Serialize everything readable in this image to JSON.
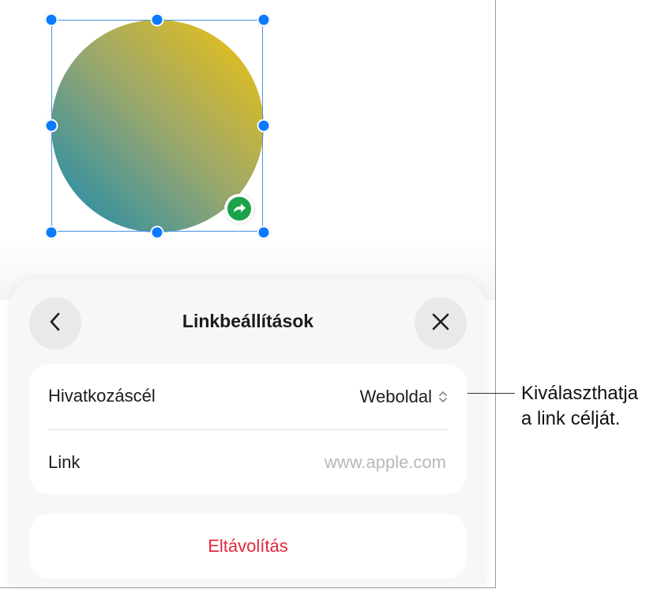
{
  "panel": {
    "title": "Linkbeállítások",
    "back_icon": "chevron-left-icon",
    "close_icon": "close-icon"
  },
  "settings": {
    "target_label": "Hivatkozáscél",
    "target_value": "Weboldal",
    "link_label": "Link",
    "link_placeholder": "www.apple.com"
  },
  "actions": {
    "remove_label": "Eltávolítás"
  },
  "callout": {
    "line1": "Kiválaszthatja",
    "line2": "a link célját."
  },
  "colors": {
    "accent": "#0a7aff",
    "destructive": "#e5283b",
    "link_badge": "#1aa34a"
  }
}
